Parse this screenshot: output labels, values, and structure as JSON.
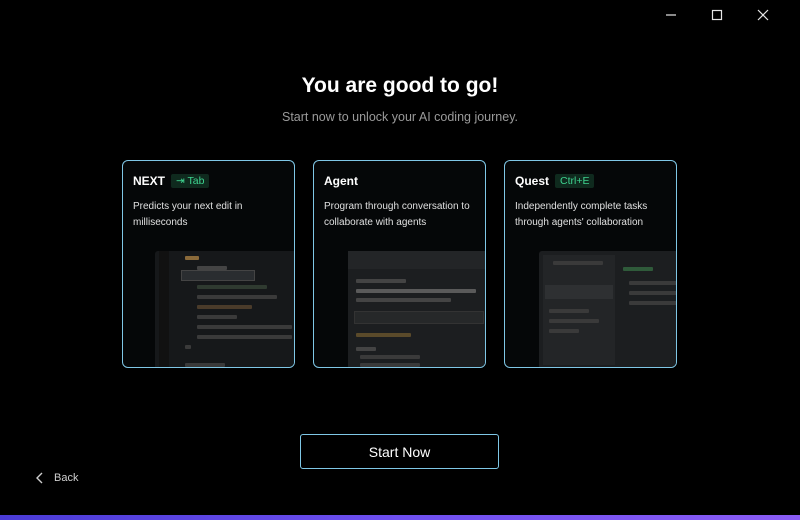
{
  "window": {
    "controls": [
      "minimize",
      "maximize",
      "close"
    ]
  },
  "heading": {
    "title": "You are good to go!",
    "subtitle": "Start now to unlock your AI coding journey."
  },
  "cards": [
    {
      "name": "NEXT",
      "shortcut": "⇥ Tab",
      "description": "Predicts your next edit in milliseconds"
    },
    {
      "name": "Agent",
      "shortcut": "",
      "description": "Program through conversation to collaborate with agents"
    },
    {
      "name": "Quest",
      "shortcut": "Ctrl+E",
      "description": "Independently complete tasks through agents' collaboration"
    }
  ],
  "start_button": {
    "label": "Start Now"
  },
  "back_link": {
    "label": "Back",
    "icon": "chevron-left-icon"
  },
  "colors": {
    "accent_border": "#7fc7e6",
    "badge_text": "#3ed38f",
    "badge_bg": "#0f2a1e",
    "bottom_bar": "#6e4ff0"
  }
}
